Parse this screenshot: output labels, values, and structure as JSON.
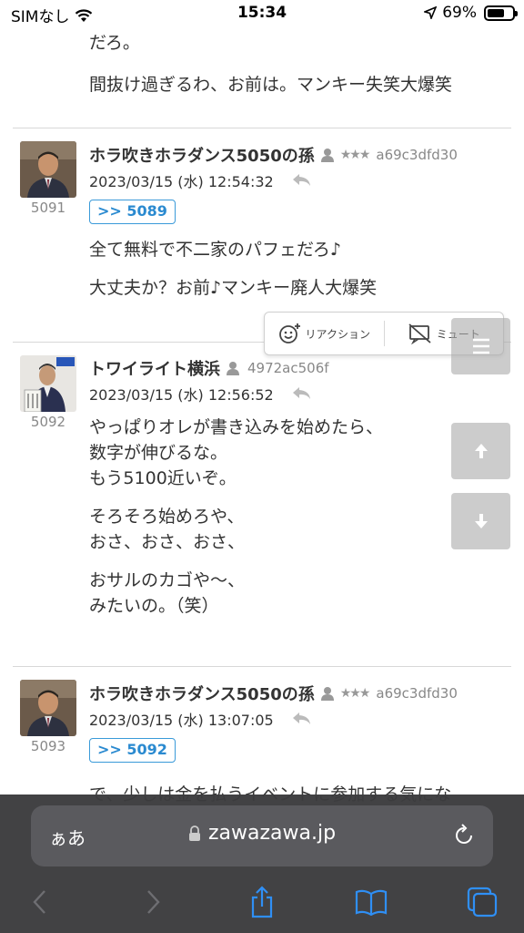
{
  "status": {
    "carrier": "SIMなし",
    "time": "15:34",
    "battery": "69%",
    "battery_level": 0.69
  },
  "top_fragment": {
    "line1": "だろ。",
    "line2": "間抜け過ぎるわ、お前は。マンキー失笑大爆笑"
  },
  "posts": [
    {
      "number": "5091",
      "name": "ホラ吹きホラダンス5050の孫",
      "stars": "★★★",
      "id": "a69c3dfd30",
      "date": "2023/03/15 (水) 12:54:32",
      "anchor": ">> 5089",
      "paragraphs": [
        "全て無料で不二家のパフェだろ♪",
        "大丈夫か？お前♪マンキー廃人大爆笑"
      ]
    },
    {
      "number": "5092",
      "name": "トワイライト横浜",
      "id": "4972ac506f",
      "date": "2023/03/15 (水) 12:56:52",
      "paragraphs": [
        "やっぱりオレが書き込みを始めたら、",
        "数字が伸びるな。",
        "もう5100近いぞ。",
        "そろそろ始めろや、",
        "おさ、おさ、おさ、",
        "おサルのカゴや〜、",
        "みたいの。（笑）"
      ]
    },
    {
      "number": "5093",
      "name": "ホラ吹きホラダンス5050の孫",
      "stars": "★★★",
      "id": "a69c3dfd30",
      "date": "2023/03/15 (水) 13:07:05",
      "anchor": ">> 5092",
      "cut_text": "で、少しは金を払うイベントに参加する気にな"
    }
  ],
  "popup": {
    "reaction": "リアクション",
    "mute": "ミュート"
  },
  "browser": {
    "text_size": "ぁあ",
    "url": "zawazawa.jp"
  }
}
